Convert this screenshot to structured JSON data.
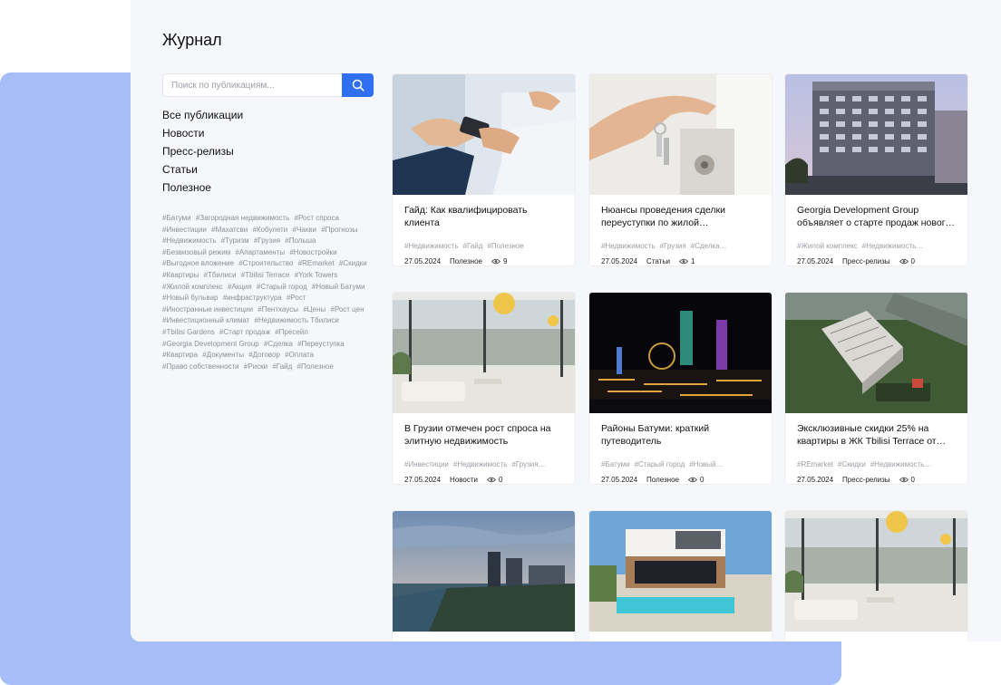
{
  "page": {
    "title": "Журнал"
  },
  "search": {
    "placeholder": "Поиск по публикациям...",
    "icon": "search-icon"
  },
  "colors": {
    "accent": "#2f6ff2",
    "backdrop": "#a6bdf7",
    "panel": "#f6f7fa"
  },
  "nav": [
    {
      "label": "Все публикации"
    },
    {
      "label": "Новости"
    },
    {
      "label": "Пресс-релизы"
    },
    {
      "label": "Статьи"
    },
    {
      "label": "Полезное"
    }
  ],
  "tags": [
    "#Батуми",
    "#Загородная недвижимость",
    "#Рост спроса",
    "#Инвестиции",
    "#Махатсви",
    "#Кобулети",
    "#Чакви",
    "#Прогнозы",
    "#Недвижимость",
    "#Туризм",
    "#Грузия",
    "#Польша",
    "#Безвизовый режим",
    "#Апартаменты",
    "#Новостройки",
    "#Выгодное вложение",
    "#Строительство",
    "#REmarket",
    "#Скидки",
    "#Квартиры",
    "#Тбилиси",
    "#Tbilisi Terrace",
    "#York Towers",
    "#Жилой комплекс",
    "#Акция",
    "#Старый город",
    "#Новый Батуми",
    "#Новый бульвар",
    "#инфраструктура",
    "#Рост",
    "#Иностранные инвестиции",
    "#Пентхаусы",
    "#Цены",
    "#Рост цен",
    "#Инвестиционный климат",
    "#Недвижимость Тбилиси",
    "#Tbilisi Gardens",
    "#Старт продаж",
    "#Пресейл",
    "#Georgia Development Group",
    "#Сделка",
    "#Переуступка",
    "#Квартира",
    "#Документы",
    "#Договор",
    "#Оплата",
    "#Право собственности",
    "#Риски",
    "#Гайд",
    "#Полезное"
  ],
  "cards": [
    {
      "title": "Гайд: Как квалифицировать клиента",
      "tags": [
        "#Недвижимость",
        "#Гайд",
        "#Полезное"
      ],
      "date": "27.05.2024",
      "category": "Полезное",
      "views": "9"
    },
    {
      "title": "Нюансы проведения сделки переуступки по жилой…",
      "tags": [
        "#Недвижимость",
        "#Грузия",
        "#Сделка…"
      ],
      "date": "27.05.2024",
      "category": "Статьи",
      "views": "1"
    },
    {
      "title": "Georgia Development Group объявляет о старте продаж новог…",
      "tags": [
        "#Жилой комплекс",
        "#Недвижимость…"
      ],
      "date": "27.05.2024",
      "category": "Пресс-релизы",
      "views": "0"
    },
    {
      "title": "В Грузии отмечен рост спроса на элитную недвижимость",
      "tags": [
        "#Инвестиции",
        "#Недвижимость",
        "#Грузия…"
      ],
      "date": "27.05.2024",
      "category": "Новости",
      "views": "0"
    },
    {
      "title": "Районы Батуми: краткий путеводитель",
      "tags": [
        "#Батуми",
        "#Старый город",
        "#Новый…"
      ],
      "date": "27.05.2024",
      "category": "Полезное",
      "views": "0"
    },
    {
      "title": "Эксклюзивные скидки 25% на квартиры в ЖК Tbilisi Terrace от…",
      "tags": [
        "#REmarket",
        "#Скидки",
        "#Недвижимость…"
      ],
      "date": "27.05.2024",
      "category": "Пресс-релизы",
      "views": "0"
    },
    {
      "title": "",
      "tags": [],
      "date": "",
      "category": "",
      "views": ""
    },
    {
      "title": "",
      "tags": [],
      "date": "",
      "category": "",
      "views": ""
    },
    {
      "title": "",
      "tags": [],
      "date": "",
      "category": "",
      "views": ""
    }
  ]
}
